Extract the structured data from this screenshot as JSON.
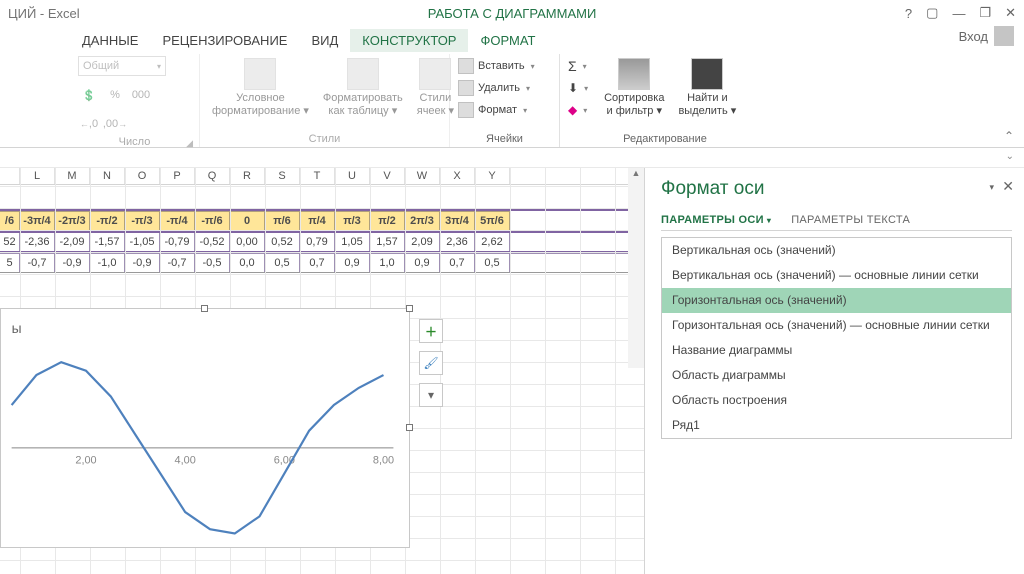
{
  "title_bar": {
    "doc_title": "ЦИЙ - Excel",
    "context_tab_group": "РАБОТА С ДИАГРАММАМИ",
    "login_label": "Вход"
  },
  "tabs": {
    "data": "ДАННЫЕ",
    "review": "РЕЦЕНЗИРОВАНИЕ",
    "view": "ВИД",
    "design": "КОНСТРУКТОР",
    "format": "ФОРМАТ"
  },
  "ribbon": {
    "number": {
      "group_label": "Число",
      "format_combo": "Общий",
      "percent": "%",
      "thousands": "000",
      "inc_dec": ",0",
      "dec_dec": ",00"
    },
    "styles": {
      "group_label": "Стили",
      "cond_fmt_1": "Условное",
      "cond_fmt_2": "форматирование",
      "fmt_table_1": "Форматировать",
      "fmt_table_2": "как таблицу",
      "cell_styles_1": "Стили",
      "cell_styles_2": "ячеек"
    },
    "cells": {
      "group_label": "Ячейки",
      "insert": "Вставить",
      "delete": "Удалить",
      "format": "Формат"
    },
    "editing": {
      "group_label": "Редактирование",
      "sort_1": "Сортировка",
      "sort_2": "и фильтр",
      "find_1": "Найти и",
      "find_2": "выделить"
    }
  },
  "columns": [
    "L",
    "M",
    "N",
    "O",
    "P",
    "Q",
    "R",
    "S",
    "T",
    "U",
    "V",
    "W",
    "X",
    "Y"
  ],
  "table": {
    "header": [
      "/6",
      "-3π/4",
      "-2π/3",
      "-π/2",
      "-π/3",
      "-π/4",
      "-π/6",
      "0",
      "π/6",
      "π/4",
      "π/3",
      "π/2",
      "2π/3",
      "3π/4",
      "5π/6"
    ],
    "row1": [
      "52",
      "-2,36",
      "-2,09",
      "-1,57",
      "-1,05",
      "-0,79",
      "-0,52",
      "0,00",
      "0,52",
      "0,79",
      "1,05",
      "1,57",
      "2,09",
      "2,36",
      "2,62"
    ],
    "row2": [
      "5",
      "-0,7",
      "-0,9",
      "-1,0",
      "-0,9",
      "-0,7",
      "-0,5",
      "0,0",
      "0,5",
      "0,7",
      "0,9",
      "1,0",
      "0,9",
      "0,7",
      "0,5"
    ]
  },
  "chart_data": {
    "type": "line",
    "title": "ы",
    "x_ticks": [
      "2,00",
      "4,00",
      "6,00",
      "8,00"
    ],
    "x": [
      0.5,
      1,
      1.5,
      2,
      2.5,
      3,
      3.5,
      4,
      4.5,
      5,
      5.5,
      6,
      6.5,
      7,
      7.5,
      8
    ],
    "y": [
      0.5,
      0.85,
      1.0,
      0.9,
      0.6,
      0.15,
      -0.3,
      -0.75,
      -0.95,
      -1.0,
      -0.8,
      -0.3,
      0.2,
      0.5,
      0.7,
      0.85
    ],
    "ylim": [
      -1.1,
      1.1
    ],
    "xlim": [
      0.5,
      8.2
    ]
  },
  "format_pane": {
    "title": "Формат оси",
    "tab_axis": "ПАРАМЕТРЫ ОСИ",
    "tab_text": "ПАРАМЕТРЫ ТЕКСТА",
    "items": [
      "Вертикальная ось (значений)",
      "Вертикальная ось (значений)   — основные линии сетки",
      "Горизонтальная ось (значений)",
      "Горизонтальная ось (значений)   — основные линии сетки",
      "Название диаграммы",
      "Область диаграммы",
      "Область построения",
      "Ряд1"
    ],
    "selected_index": 2
  }
}
